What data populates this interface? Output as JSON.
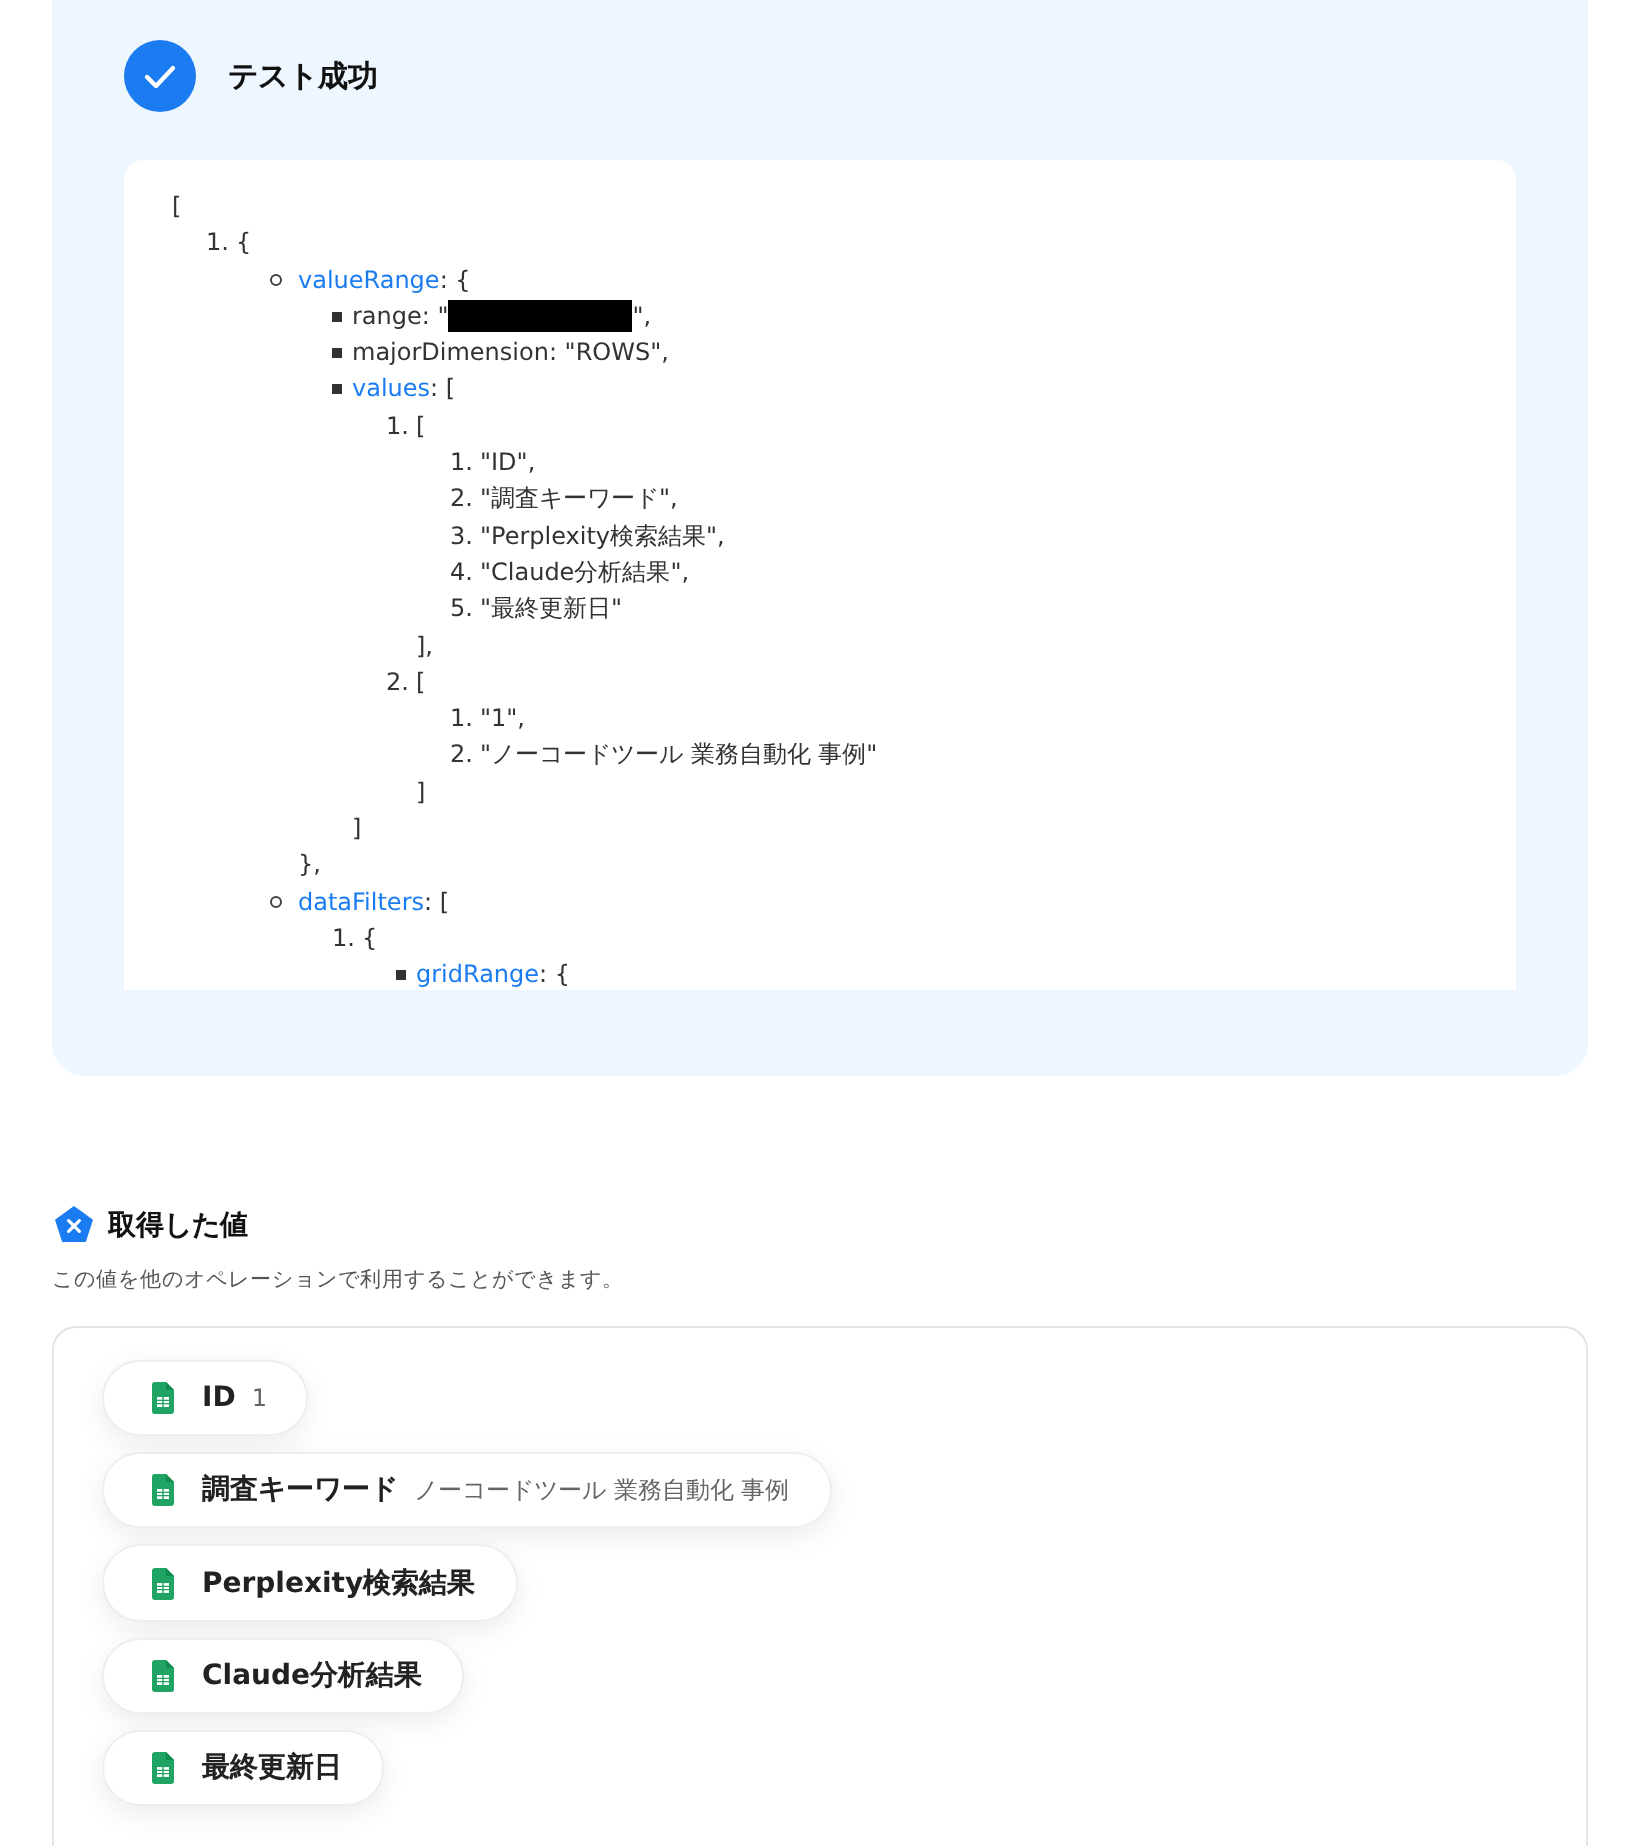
{
  "test_result": {
    "passed": true,
    "title": "テスト成功",
    "output": {
      "open": "[",
      "kind": "ordered",
      "items": [
        {
          "number": "1.",
          "text": "{",
          "list": {
            "kind": "circle",
            "items": [
              {
                "key": "valueRange",
                "text": ": {",
                "list": {
                  "kind": "square",
                  "items": [
                    {
                      "text": "range: \"",
                      "redacted": true,
                      "tail": "\","
                    },
                    {
                      "text": "majorDimension: \"ROWS\","
                    },
                    {
                      "key": "values",
                      "text": ": [",
                      "close": "]",
                      "list": {
                        "kind": "ordered",
                        "items": [
                          {
                            "number": "1.",
                            "text": "[",
                            "close": "],",
                            "list": {
                              "kind": "ordered",
                              "items": [
                                {
                                  "number": "1.",
                                  "text": "\"ID\","
                                },
                                {
                                  "number": "2.",
                                  "text": "\"調査キーワード\","
                                },
                                {
                                  "number": "3.",
                                  "text": "\"Perplexity検索結果\","
                                },
                                {
                                  "number": "4.",
                                  "text": "\"Claude分析結果\","
                                },
                                {
                                  "number": "5.",
                                  "text": "\"最終更新日\""
                                }
                              ]
                            }
                          },
                          {
                            "number": "2.",
                            "text": "[",
                            "close": "]",
                            "list": {
                              "kind": "ordered",
                              "items": [
                                {
                                  "number": "1.",
                                  "text": "\"1\","
                                },
                                {
                                  "number": "2.",
                                  "text": "\"ノーコードツール 業務自動化 事例\""
                                }
                              ]
                            }
                          }
                        ]
                      }
                    }
                  ]
                },
                "close": "},"
              },
              {
                "key": "dataFilters",
                "text": ": [",
                "list": {
                  "kind": "ordered",
                  "items": [
                    {
                      "number": "1.",
                      "text": "{",
                      "list": {
                        "kind": "square",
                        "items": [
                          {
                            "key": "gridRange",
                            "text": ": {"
                          }
                        ]
                      }
                    }
                  ]
                }
              }
            ]
          }
        }
      ]
    }
  },
  "values_section": {
    "title": "取得した値",
    "description": "この値を他のオペレーションで利用することができます。",
    "items": [
      {
        "label": "ID",
        "value": "1"
      },
      {
        "label": "調査キーワード",
        "value": "ノーコードツール 業務自動化 事例"
      },
      {
        "label": "Perplexity検索結果"
      },
      {
        "label": "Claude分析結果"
      },
      {
        "label": "最終更新日"
      }
    ]
  }
}
